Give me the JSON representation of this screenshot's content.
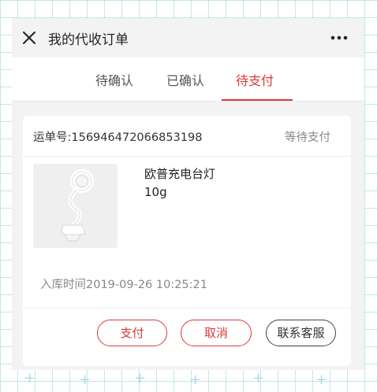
{
  "nav": {
    "title": "我的代收订单",
    "close_icon": "close-icon",
    "more_icon": "more-icon"
  },
  "tabs": [
    {
      "label": "待确认",
      "active": false
    },
    {
      "label": "已确认",
      "active": false
    },
    {
      "label": "待支付",
      "active": true
    }
  ],
  "order": {
    "waybill": "运单号:156946472066853198",
    "status": "等待支付",
    "product": {
      "name": "欧普充电台灯",
      "weight": "10g"
    },
    "stock_in_time": "入库时间2019-09-26 10:25:21",
    "actions": {
      "pay": "支付",
      "cancel": "取消",
      "contact": "联系客服"
    }
  },
  "colors": {
    "accent": "#d93a3a",
    "background": "#f3f3f3"
  }
}
